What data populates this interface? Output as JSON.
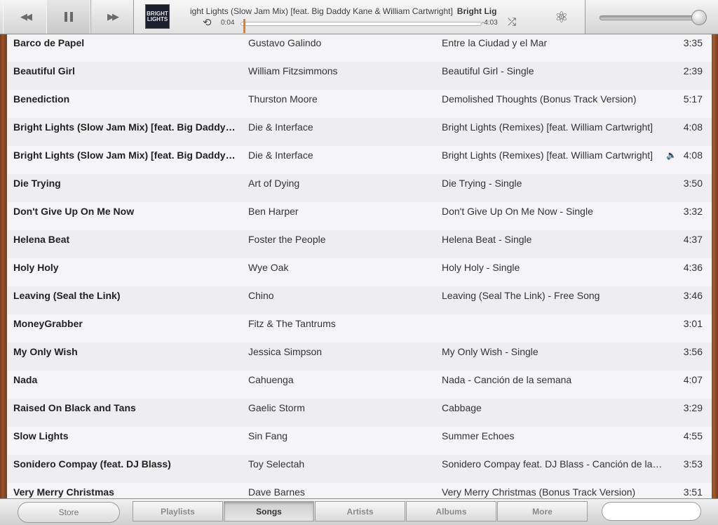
{
  "controls": {
    "rewind_icon": "rewind-icon",
    "pause_icon": "pause-icon",
    "forward_icon": "fast-forward-icon"
  },
  "now_playing": {
    "title_line": "ight Lights (Slow Jam Mix) [feat. Big Daddy Kane & William Cartwright]",
    "title_line_bold": "Bright Lig",
    "artwork_text": "BRIGHT LIGHTS",
    "elapsed": "0:04",
    "remaining": "-4:03",
    "progress_fraction": 0.016,
    "accent": "#f07a22"
  },
  "volume": {
    "level": 1.0
  },
  "songs": [
    {
      "title": "Barco de Papel",
      "artist": "Gustavo Galindo",
      "album": "Entre la Ciudad y el Mar",
      "time": "3:35"
    },
    {
      "title": "Beautiful Girl",
      "artist": "William Fitzsimmons",
      "album": "Beautiful Girl - Single",
      "time": "2:39"
    },
    {
      "title": "Benediction",
      "artist": "Thurston Moore",
      "album": "Demolished Thoughts (Bonus Track Version)",
      "time": "5:17"
    },
    {
      "title": "Bright Lights (Slow Jam Mix) [feat. Big Daddy…",
      "artist": "Die & Interface",
      "album": "Bright Lights (Remixes) [feat. William Cartwright]",
      "time": "4:08"
    },
    {
      "title": "Bright Lights (Slow Jam Mix) [feat. Big Daddy…",
      "artist": "Die & Interface",
      "album": "Bright Lights (Remixes) [feat. William Cartwright]",
      "time": "4:08",
      "playing": true
    },
    {
      "title": "Die Trying",
      "artist": "Art of Dying",
      "album": "Die Trying - Single",
      "time": "3:50"
    },
    {
      "title": "Don't Give Up On Me Now",
      "artist": "Ben Harper",
      "album": "Don't Give Up On Me Now - Single",
      "time": "3:32"
    },
    {
      "title": "Helena Beat",
      "artist": "Foster the People",
      "album": "Helena Beat - Single",
      "time": "4:37"
    },
    {
      "title": "Holy Holy",
      "artist": "Wye Oak",
      "album": "Holy Holy - Single",
      "time": "4:36"
    },
    {
      "title": "Leaving (Seal the Link)",
      "artist": "Chino",
      "album": "Leaving (Seal The Link) - Free Song",
      "time": "3:46"
    },
    {
      "title": "MoneyGrabber",
      "artist": "Fitz & The Tantrums",
      "album": "",
      "time": "3:01"
    },
    {
      "title": "My Only Wish",
      "artist": "Jessica Simpson",
      "album": "My Only Wish - Single",
      "time": "3:56"
    },
    {
      "title": "Nada",
      "artist": "Cahuenga",
      "album": "Nada - Canción de la semana",
      "time": "4:07"
    },
    {
      "title": "Raised On Black and Tans",
      "artist": "Gaelic Storm",
      "album": "Cabbage",
      "time": "3:29"
    },
    {
      "title": "Slow Lights",
      "artist": "Sin Fang",
      "album": "Summer Echoes",
      "time": "4:55"
    },
    {
      "title": "Sonidero Compay (feat. DJ Blass)",
      "artist": "Toy Selectah",
      "album": "Sonidero Compay feat. DJ Blass - Canción de la…",
      "time": "3:53"
    },
    {
      "title": "Very Merry Christmas",
      "artist": "Dave Barnes",
      "album": "Very Merry Christmas (Bonus Track Version)",
      "time": "3:51"
    }
  ],
  "bottom": {
    "store_label": "Store",
    "tabs": [
      "Playlists",
      "Songs",
      "Artists",
      "Albums",
      "More"
    ],
    "active_tab": "Songs",
    "search_placeholder": ""
  }
}
